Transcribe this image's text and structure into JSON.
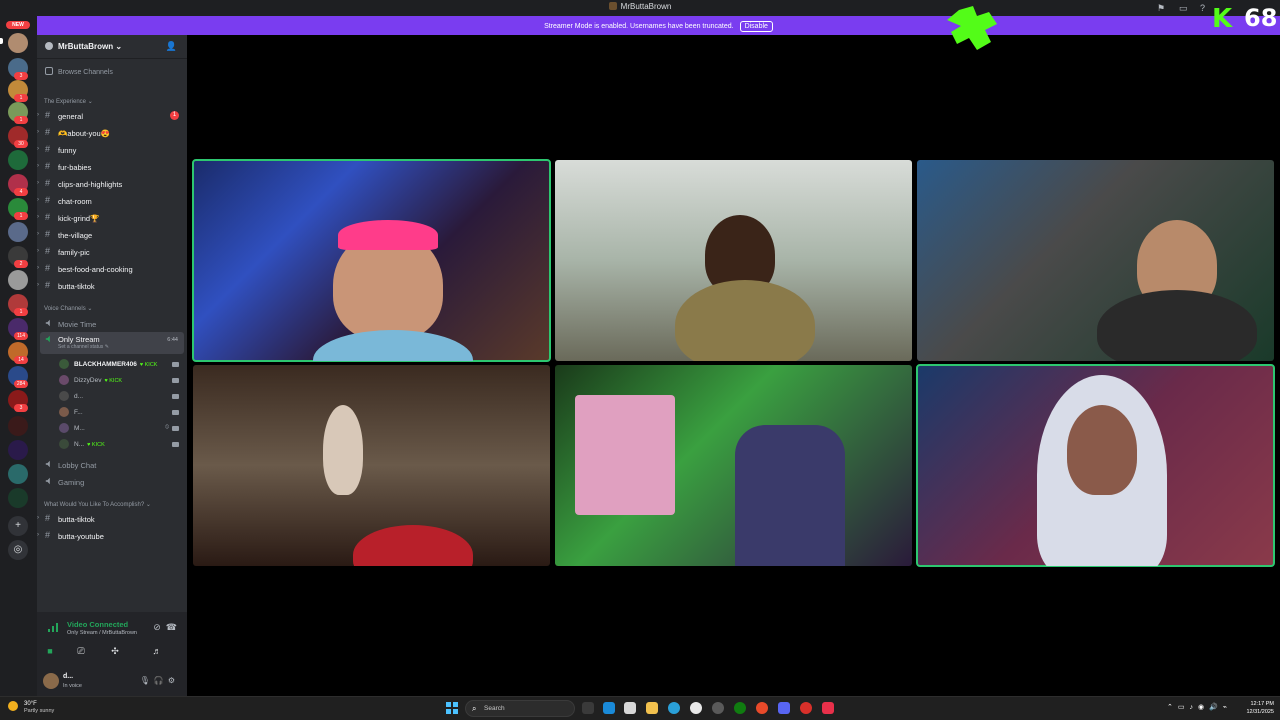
{
  "window": {
    "title": "MrButtaBrown"
  },
  "banner": {
    "message": "Streamer Mode is enabled. Usernames have been truncated.",
    "button": "Disable"
  },
  "servers": {
    "new_badge": "NEW",
    "badges": [
      "3",
      "1",
      "1",
      "30",
      "4",
      "1",
      "2",
      "1",
      "114",
      "14",
      "284",
      "3"
    ]
  },
  "server_header": {
    "name": "MrButtaBrown"
  },
  "browse_channels": "Browse Channels",
  "categories": {
    "experience": "The Experience",
    "voice": "Voice Channels",
    "accomplish": "What Would You Like To Accomplish?"
  },
  "text_channels": [
    {
      "label": "general",
      "unread": "1"
    },
    {
      "label": "🫶about-you😍"
    },
    {
      "label": "funny"
    },
    {
      "label": "fur-babies"
    },
    {
      "label": "clips-and-highlights"
    },
    {
      "label": "chat-room"
    },
    {
      "label": "kick-grind🏆"
    },
    {
      "label": "the-village"
    },
    {
      "label": "family-pic"
    },
    {
      "label": "best-food-and-cooking"
    },
    {
      "label": "butta-tiktok"
    }
  ],
  "voice_channels": {
    "movie_time": "Movie Time",
    "only_stream": "Only Stream",
    "only_stream_timer": "6:44",
    "only_stream_status": "Set a channel status ✎",
    "lobby_chat": "Lobby Chat",
    "gaming": "Gaming"
  },
  "voice_users": [
    {
      "name": "BLACKHAMMER406",
      "tag": "KICK"
    },
    {
      "name": "DizzyDev",
      "tag": "KICK"
    },
    {
      "name": "d...",
      "tag": ""
    },
    {
      "name": "F...",
      "tag": ""
    },
    {
      "name": "M...",
      "tag": ""
    },
    {
      "name": "N...",
      "tag": "KICK"
    }
  ],
  "accomplish_channels": [
    "butta-tiktok",
    "butta-youtube"
  ],
  "voice_panel": {
    "title": "Video Connected",
    "subtitle": "Only Stream / MrButtaBrown"
  },
  "user": {
    "name": "d...",
    "status": "In voice"
  },
  "overlay": {
    "kick_count": "68"
  },
  "taskbar": {
    "temp": "30°F",
    "weather": "Partly sunny",
    "search": "Search",
    "time": "12:17 PM",
    "date": "12/31/2025"
  },
  "colors": {
    "accent": "#5865f2",
    "banner": "#7a3df0",
    "speaking": "#2dc770",
    "kick": "#53fc18"
  }
}
